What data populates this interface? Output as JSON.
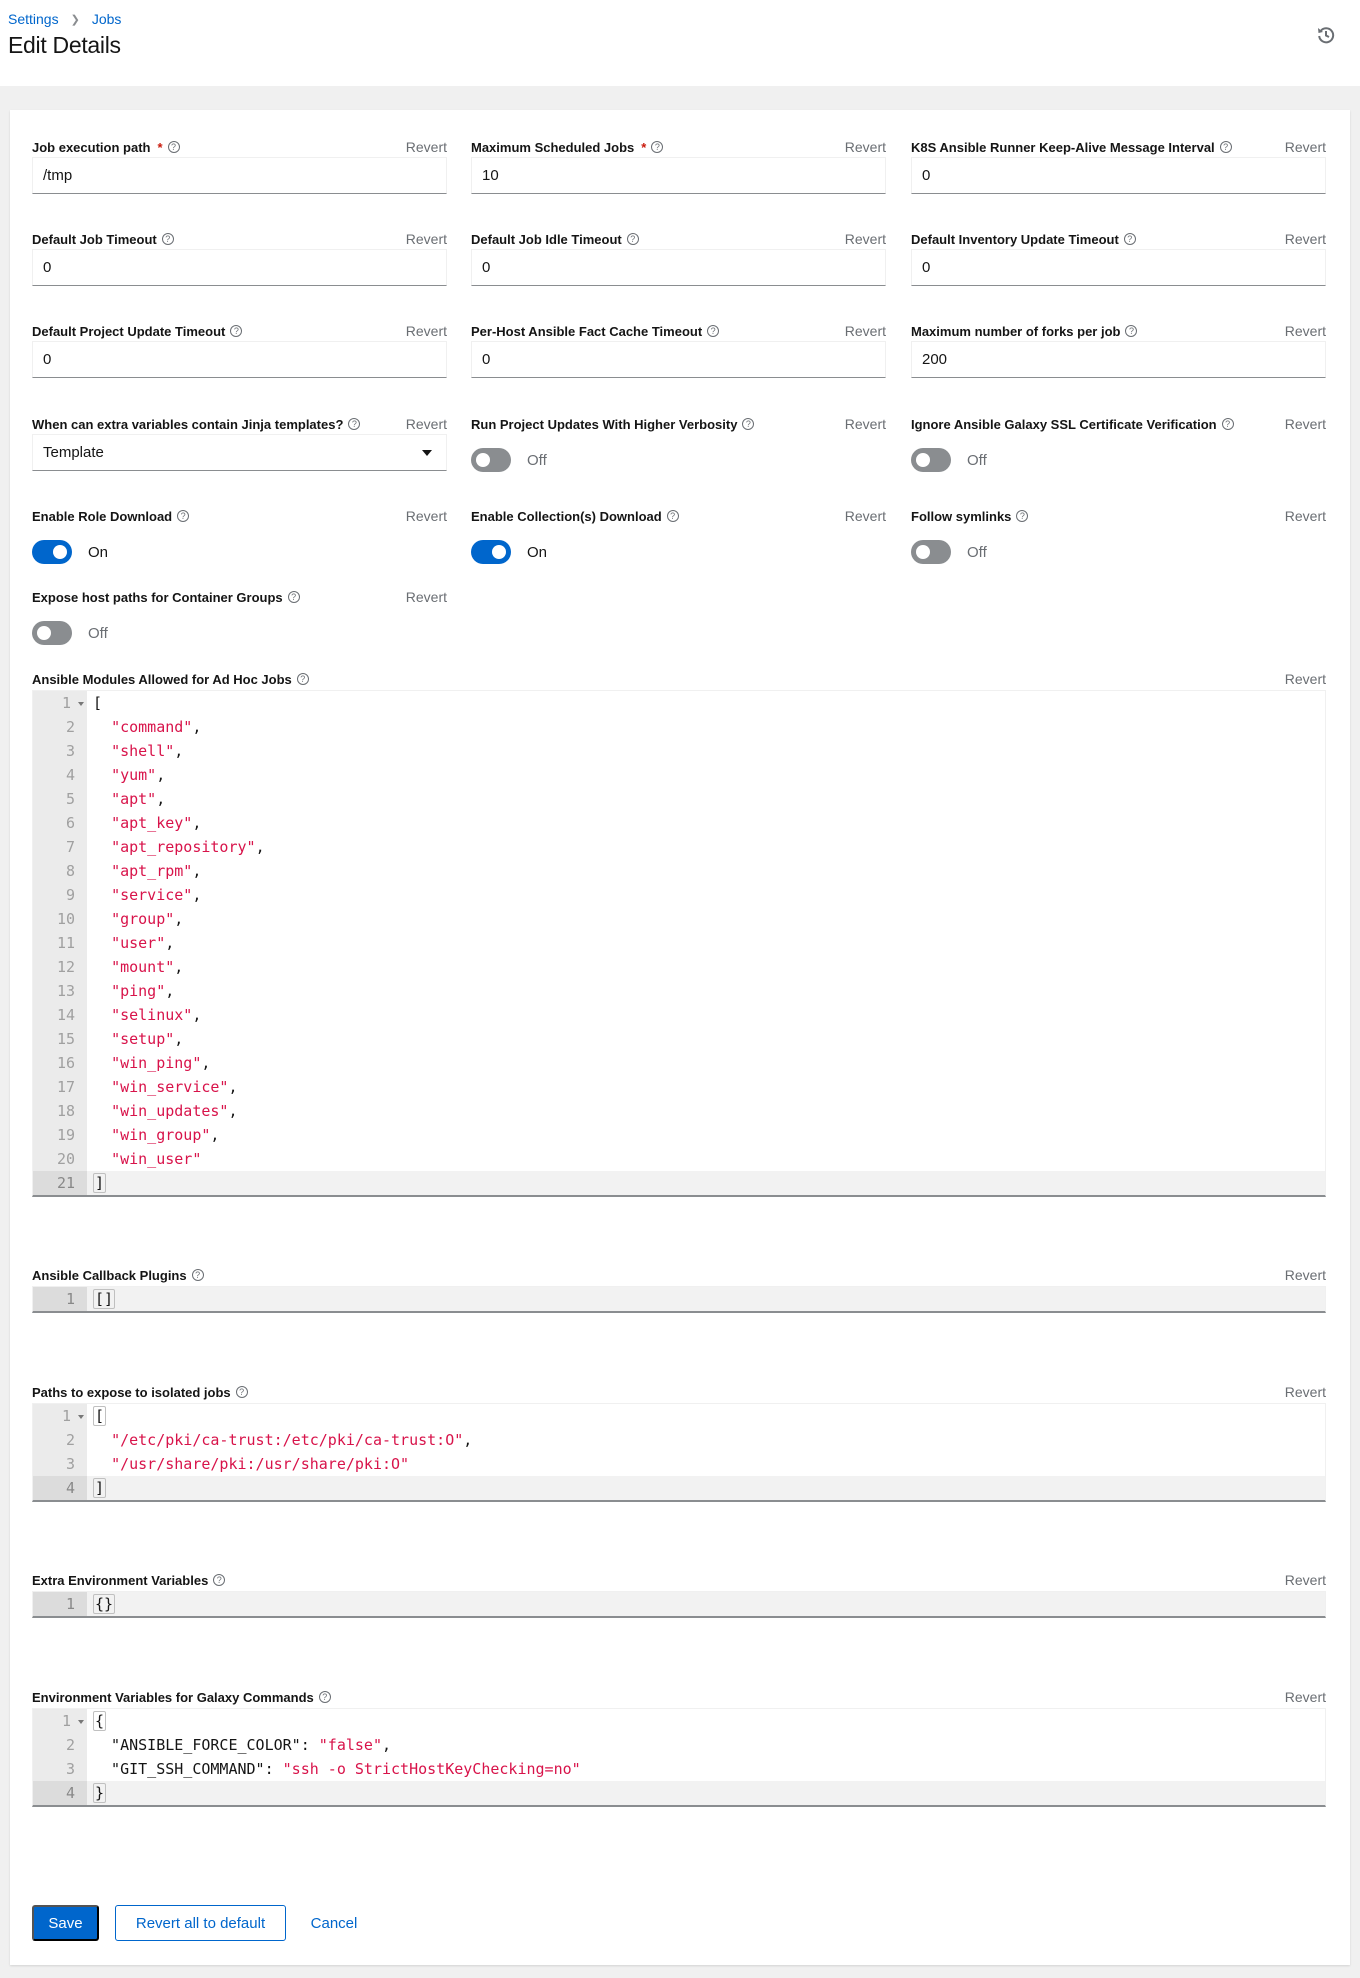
{
  "header": {
    "breadcrumb": [
      {
        "label": "Settings"
      },
      {
        "label": "Jobs"
      }
    ],
    "title": "Edit Details",
    "history_icon": "history-icon"
  },
  "revert_label": "Revert",
  "fields": {
    "job_execution_path": {
      "label": "Job execution path",
      "required": true,
      "value": "/tmp"
    },
    "max_scheduled_jobs": {
      "label": "Maximum Scheduled Jobs",
      "required": true,
      "value": "10"
    },
    "k8s_keepalive": {
      "label": "K8S Ansible Runner Keep-Alive Message Interval",
      "value": "0"
    },
    "default_job_timeout": {
      "label": "Default Job Timeout",
      "value": "0"
    },
    "default_job_idle_timeout": {
      "label": "Default Job Idle Timeout",
      "value": "0"
    },
    "default_inventory_update_timeout": {
      "label": "Default Inventory Update Timeout",
      "value": "0"
    },
    "default_project_update_timeout": {
      "label": "Default Project Update Timeout",
      "value": "0"
    },
    "fact_cache_timeout": {
      "label": "Per-Host Ansible Fact Cache Timeout",
      "value": "0"
    },
    "max_forks": {
      "label": "Maximum number of forks per job",
      "value": "200"
    },
    "jinja_templates": {
      "label": "When can extra variables contain Jinja templates?",
      "value": "Template"
    },
    "higher_verbosity": {
      "label": "Run Project Updates With Higher Verbosity",
      "state": "Off"
    },
    "ignore_galaxy_ssl": {
      "label": "Ignore Ansible Galaxy SSL Certificate Verification",
      "state": "Off"
    },
    "enable_role_download": {
      "label": "Enable Role Download",
      "state": "On"
    },
    "enable_collection_download": {
      "label": "Enable Collection(s) Download",
      "state": "On"
    },
    "follow_symlinks": {
      "label": "Follow symlinks",
      "state": "Off"
    },
    "expose_host_paths": {
      "label": "Expose host paths for Container Groups",
      "state": "Off"
    }
  },
  "editors": {
    "adhoc_modules": {
      "label": "Ansible Modules Allowed for Ad Hoc Jobs",
      "items": [
        "command",
        "shell",
        "yum",
        "apt",
        "apt_key",
        "apt_repository",
        "apt_rpm",
        "service",
        "group",
        "user",
        "mount",
        "ping",
        "selinux",
        "setup",
        "win_ping",
        "win_service",
        "win_updates",
        "win_group",
        "win_user"
      ]
    },
    "callback_plugins": {
      "label": "Ansible Callback Plugins",
      "content": "[]"
    },
    "isolated_paths": {
      "label": "Paths to expose to isolated jobs",
      "items": [
        "/etc/pki/ca-trust:/etc/pki/ca-trust:O",
        "/usr/share/pki:/usr/share/pki:O"
      ]
    },
    "extra_env": {
      "label": "Extra Environment Variables",
      "content": "{}"
    },
    "galaxy_env": {
      "label": "Environment Variables for Galaxy Commands",
      "pairs": [
        {
          "key": "ANSIBLE_FORCE_COLOR",
          "value": "false"
        },
        {
          "key": "GIT_SSH_COMMAND",
          "value": "ssh -o StrictHostKeyChecking=no"
        }
      ]
    }
  },
  "actions": {
    "save": "Save",
    "revert_all": "Revert all to default",
    "cancel": "Cancel"
  }
}
